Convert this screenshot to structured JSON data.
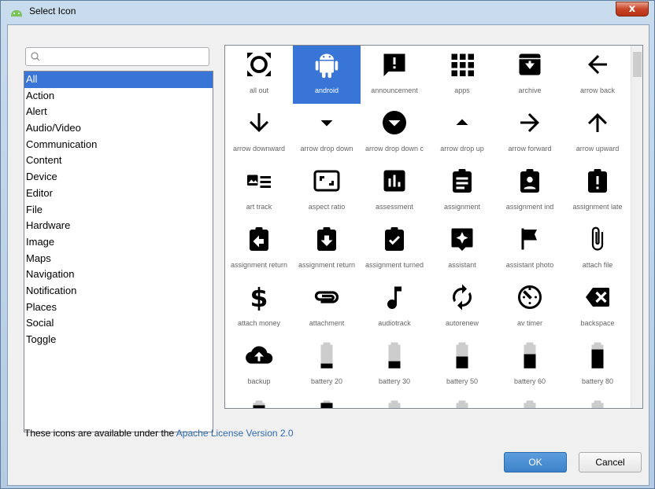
{
  "window": {
    "title": "Select Icon",
    "close_label": "x"
  },
  "search": {
    "placeholder": ""
  },
  "categories": [
    "All",
    "Action",
    "Alert",
    "Audio/Video",
    "Communication",
    "Content",
    "Device",
    "Editor",
    "File",
    "Hardware",
    "Image",
    "Maps",
    "Navigation",
    "Notification",
    "Places",
    "Social",
    "Toggle"
  ],
  "selected_category": "All",
  "icons": [
    {
      "label": "all out",
      "icon": "all-out-icon"
    },
    {
      "label": "android",
      "icon": "android-icon"
    },
    {
      "label": "announcement",
      "icon": "announcement-icon"
    },
    {
      "label": "apps",
      "icon": "apps-icon"
    },
    {
      "label": "archive",
      "icon": "archive-icon"
    },
    {
      "label": "arrow back",
      "icon": "arrow-back-icon"
    },
    {
      "label": "arrow downward",
      "icon": "arrow-downward-icon"
    },
    {
      "label": "arrow drop down",
      "icon": "arrow-drop-down-icon"
    },
    {
      "label": "arrow drop down c",
      "icon": "arrow-drop-down-circle-icon"
    },
    {
      "label": "arrow drop up",
      "icon": "arrow-drop-up-icon"
    },
    {
      "label": "arrow forward",
      "icon": "arrow-forward-icon"
    },
    {
      "label": "arrow upward",
      "icon": "arrow-upward-icon"
    },
    {
      "label": "art track",
      "icon": "art-track-icon"
    },
    {
      "label": "aspect ratio",
      "icon": "aspect-ratio-icon"
    },
    {
      "label": "assessment",
      "icon": "assessment-icon"
    },
    {
      "label": "assignment",
      "icon": "assignment-icon"
    },
    {
      "label": "assignment ind",
      "icon": "assignment-ind-icon"
    },
    {
      "label": "assignment late",
      "icon": "assignment-late-icon"
    },
    {
      "label": "assignment return",
      "icon": "assignment-return-icon"
    },
    {
      "label": "assignment return",
      "icon": "assignment-returned-icon"
    },
    {
      "label": "assignment turned",
      "icon": "assignment-turned-in-icon"
    },
    {
      "label": "assistant",
      "icon": "assistant-icon"
    },
    {
      "label": "assistant photo",
      "icon": "assistant-photo-icon"
    },
    {
      "label": "attach file",
      "icon": "attach-file-icon"
    },
    {
      "label": "attach money",
      "icon": "attach-money-icon"
    },
    {
      "label": "attachment",
      "icon": "attachment-icon"
    },
    {
      "label": "audiotrack",
      "icon": "audiotrack-icon"
    },
    {
      "label": "autorenew",
      "icon": "autorenew-icon"
    },
    {
      "label": "av timer",
      "icon": "av-timer-icon"
    },
    {
      "label": "backspace",
      "icon": "backspace-icon"
    },
    {
      "label": "backup",
      "icon": "backup-icon"
    },
    {
      "label": "battery 20",
      "icon": "battery-20-icon"
    },
    {
      "label": "battery 30",
      "icon": "battery-30-icon"
    },
    {
      "label": "battery 50",
      "icon": "battery-50-icon"
    },
    {
      "label": "battery 60",
      "icon": "battery-60-icon"
    },
    {
      "label": "battery 80",
      "icon": "battery-80-icon"
    },
    {
      "label": "",
      "icon": "battery-90-icon"
    },
    {
      "label": "",
      "icon": "battery-full-icon"
    },
    {
      "label": "",
      "icon": "battery-charging-icon"
    },
    {
      "label": "",
      "icon": "battery-charging-icon"
    },
    {
      "label": "",
      "icon": "battery-charging-icon"
    },
    {
      "label": "",
      "icon": "battery-charging-icon"
    }
  ],
  "selected_icon": "android",
  "footer": {
    "text": "These icons are available under the ",
    "link": "Apache License Version 2.0"
  },
  "buttons": {
    "ok": "OK",
    "cancel": "Cancel"
  },
  "colors": {
    "selection": "#3875d7",
    "link": "#2f6cb5",
    "ok_button": "#3d82c9"
  }
}
